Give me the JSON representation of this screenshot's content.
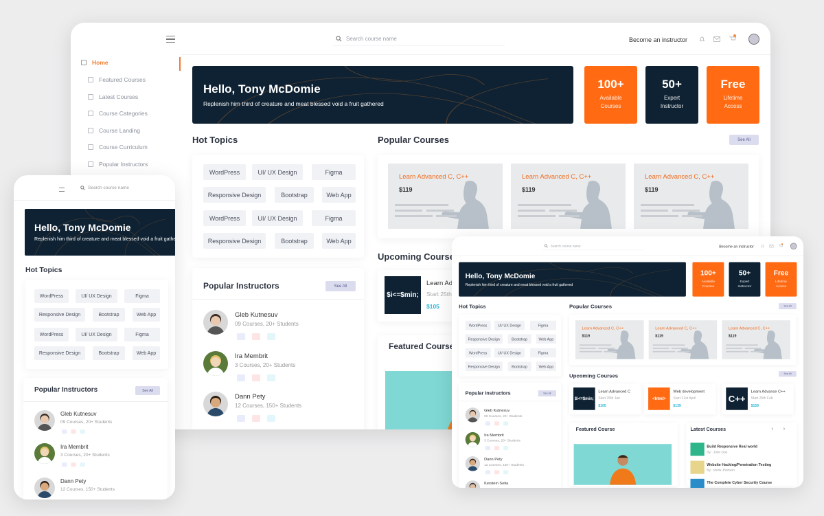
{
  "header": {
    "search_placeholder": "Search course name",
    "become_instructor": "Become an instructor"
  },
  "sidebar": {
    "items": [
      {
        "label": "Home",
        "active": true
      },
      {
        "label": "Featured Courses"
      },
      {
        "label": "Latest Courses"
      },
      {
        "label": "Course Categories"
      },
      {
        "label": "Course Landing"
      },
      {
        "label": "Course Curriculum"
      },
      {
        "label": "Popular Instructors"
      }
    ]
  },
  "hero": {
    "title": "Hello, Tony McDomie",
    "subtitle": "Replenish him third of creature and meat blessed void a fruit gathered"
  },
  "stats": [
    {
      "value": "100+",
      "label": "Available\nCourses",
      "color": "#ff6a13"
    },
    {
      "value": "50+",
      "label": "Expert\nInstructor",
      "color": "#0e2233"
    },
    {
      "value": "Free",
      "label": "Lifetime\nAccess",
      "color": "#ff6a13"
    }
  ],
  "hot_topics": {
    "title": "Hot Topics",
    "tags": [
      "WordPress",
      "UI/ UX Design",
      "Figma",
      "Responsive Design",
      "Bootstrap",
      "Web App",
      "WordPress",
      "UI/ UX Design",
      "Figma",
      "Responsive Design",
      "Bootstrap",
      "Web App"
    ]
  },
  "popular_courses": {
    "title": "Popular Courses",
    "see_all": "See All",
    "items": [
      {
        "title": "Learn Advanced C, C++",
        "price": "$119"
      },
      {
        "title": "Learn Advanced C, C++",
        "price": "$119"
      },
      {
        "title": "Learn Advanced C, C++",
        "price": "$119"
      }
    ]
  },
  "upcoming": {
    "title": "Upcoming Courses",
    "see_all": "See All",
    "items": [
      {
        "thumb": "$i<=$min;",
        "thumb_color": "#0e2233",
        "title": "Learn Advanced C",
        "start": "Start 25th Jan",
        "price": "$105"
      },
      {
        "thumb": "<html>",
        "thumb_color": "#ff6a13",
        "title": "Web development",
        "start": "Start 21st April",
        "price": "$139"
      },
      {
        "thumb": "C++",
        "thumb_color": "#0e2233",
        "title": "Learn Advance C++",
        "start": "Start 25th Feb",
        "price": "$159"
      }
    ]
  },
  "instructors": {
    "title": "Popular Instructors",
    "see_all": "See All",
    "items": [
      {
        "name": "Gleb Kutnesuv",
        "meta": "09 Courses, 20+ Students"
      },
      {
        "name": "Ira Membrit",
        "meta": "3 Courses, 20+ Students"
      },
      {
        "name": "Dann Pety",
        "meta": "12 Courses, 150+ Students"
      },
      {
        "name": "Kerstein Setia",
        "meta": ""
      }
    ]
  },
  "featured": {
    "title": "Featured Course"
  },
  "latest": {
    "title": "Latest Courses",
    "items": [
      {
        "title": "Build Responsive Real world",
        "by": "By : John Doe"
      },
      {
        "title": "Website Hacking/Penetration Testing",
        "by": "By : Moris Jhonson"
      },
      {
        "title": "The Complete Cyber Security Course",
        "by": ""
      }
    ]
  },
  "colors": {
    "accent": "#ff6a13",
    "navy": "#0e2233",
    "price": "#2bb5d8"
  }
}
